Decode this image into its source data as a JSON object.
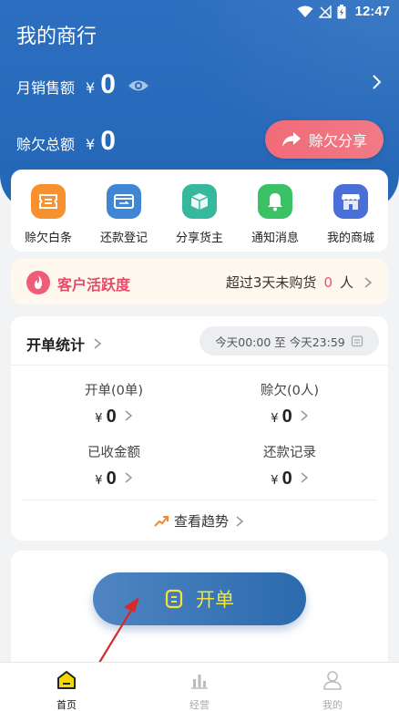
{
  "status_bar": {
    "time": "12:47",
    "icons": [
      "wifi-icon",
      "signal-off-icon",
      "battery-charging-icon"
    ]
  },
  "header": {
    "title": "我的商行",
    "monthly_sales": {
      "label": "月销售额",
      "currency": "¥",
      "value": "0"
    },
    "total_credit": {
      "label": "赊欠总额",
      "currency": "¥",
      "value": "0"
    },
    "share_button": "赊欠分享"
  },
  "quick_actions": [
    {
      "label": "赊欠白条",
      "icon": "ticket-icon",
      "color": "#f7912f"
    },
    {
      "label": "还款登记",
      "icon": "card-icon",
      "color": "#3f87d4"
    },
    {
      "label": "分享货主",
      "icon": "box-icon",
      "color": "#35b89b"
    },
    {
      "label": "通知消息",
      "icon": "bell-icon",
      "color": "#3ac163"
    },
    {
      "label": "我的商城",
      "icon": "store-icon",
      "color": "#4a6fd6"
    }
  ],
  "customer_activity": {
    "title": "客户活跃度",
    "prefix": "超过3天未购货",
    "count": "0",
    "unit": "人"
  },
  "order_stats": {
    "title": "开单统计",
    "date_range": "今天00:00 至 今天23:59",
    "items": [
      {
        "label": "开单(0单)",
        "currency": "¥",
        "value": "0"
      },
      {
        "label": "赊欠(0人)",
        "currency": "¥",
        "value": "0"
      },
      {
        "label": "已收金额",
        "currency": "¥",
        "value": "0"
      },
      {
        "label": "还款记录",
        "currency": "¥",
        "value": "0"
      }
    ],
    "trend_link": "查看趋势"
  },
  "primary_action": {
    "label": "开单"
  },
  "tabbar": [
    {
      "label": "首页",
      "icon": "home-icon",
      "active": true
    },
    {
      "label": "经营",
      "icon": "chart-icon",
      "active": false
    },
    {
      "label": "我的",
      "icon": "user-icon",
      "active": false
    }
  ],
  "colors": {
    "brand_blue": "#2466b6",
    "accent_pink": "#f07b86",
    "highlight_yellow": "#f5e33a"
  }
}
